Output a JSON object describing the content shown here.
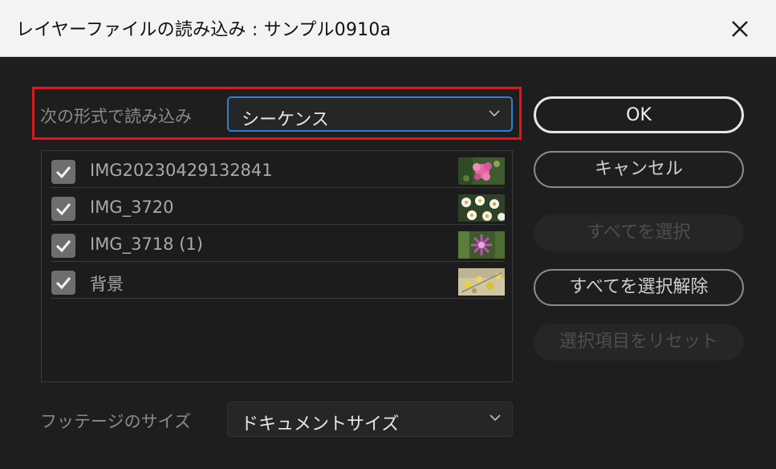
{
  "window": {
    "title": "レイヤーファイルの読み込み : サンプル0910a",
    "close_icon": "close-icon"
  },
  "import_as": {
    "label": "次の形式で読み込み",
    "value": "シーケンス"
  },
  "layers": [
    {
      "name": "IMG20230429132841",
      "checked": true,
      "thumb": "pink-flower"
    },
    {
      "name": "IMG_3720",
      "checked": true,
      "thumb": "white-daisies"
    },
    {
      "name": "IMG_3718 (1)",
      "checked": true,
      "thumb": "purple-flower"
    },
    {
      "name": "背景",
      "checked": true,
      "thumb": "yellow-blossoms"
    }
  ],
  "footage_size": {
    "label": "フッテージのサイズ",
    "value": "ドキュメントサイズ"
  },
  "buttons": {
    "ok": "OK",
    "cancel": "キャンセル",
    "select_all": "すべてを選択",
    "deselect_all": "すべてを選択解除",
    "reset_selection": "選択項目をリセット"
  },
  "colors": {
    "highlight": "#e0161c",
    "background": "#1e1e1e",
    "titlebar": "#f3f3f3"
  }
}
